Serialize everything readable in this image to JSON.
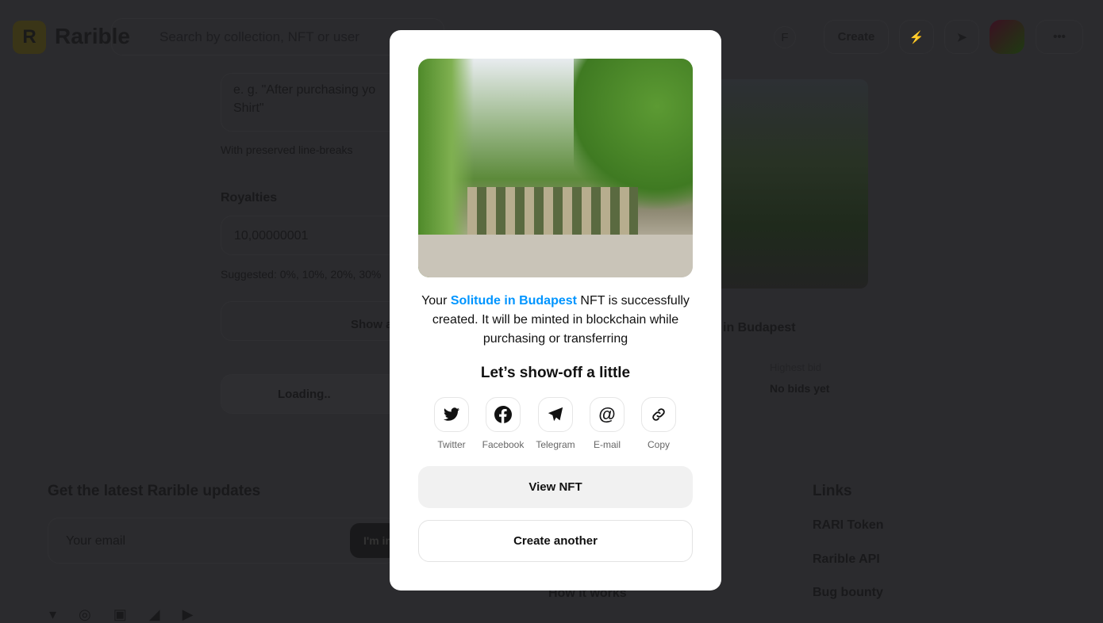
{
  "header": {
    "brand": "Rarible",
    "logo_letter": "R",
    "search_placeholder": "Search by collection, NFT or user",
    "user_initial": "F",
    "create_label": "Create",
    "icons": [
      "lightning-icon",
      "send-icon",
      "avatar",
      "more-icon"
    ]
  },
  "form": {
    "description_placeholder_line1": "e. g. \"After purchasing yo",
    "description_placeholder_line2": "Shirt\"",
    "description_hint": "With preserved line-breaks",
    "royalties_label": "Royalties",
    "royalties_value": "10,00000001",
    "royalties_hint": "Suggested: 0%, 10%, 20%, 30%",
    "show_advanced": "Show a",
    "loading": "Loading.."
  },
  "preview": {
    "title_fragment": "in Budapest",
    "highest_bid_label": "Highest bid",
    "highest_bid_value": "No bids yet"
  },
  "footer": {
    "updates_title": "Get the latest Rarible updates",
    "email_placeholder": "Your email",
    "subscribe_label": "I'm in",
    "links_title": "Links",
    "links": [
      "RARI Token",
      "Rarible API",
      "Bug bounty"
    ],
    "how_it_works": "How it works"
  },
  "modal": {
    "msg_prefix": "Your ",
    "nft_name": "Solitude in Budapest",
    "msg_suffix": " NFT is successfully created. It will be minted in blockchain while purchasing or transferring",
    "share_title": "Let’s show-off a little",
    "share": [
      {
        "label": "Twitter",
        "icon": "twitter-icon"
      },
      {
        "label": "Facebook",
        "icon": "facebook-icon"
      },
      {
        "label": "Telegram",
        "icon": "telegram-icon"
      },
      {
        "label": "E-mail",
        "icon": "email-icon"
      },
      {
        "label": "Copy",
        "icon": "link-icon"
      }
    ],
    "view_label": "View NFT",
    "create_another_label": "Create another",
    "accent": "#0095ff"
  }
}
